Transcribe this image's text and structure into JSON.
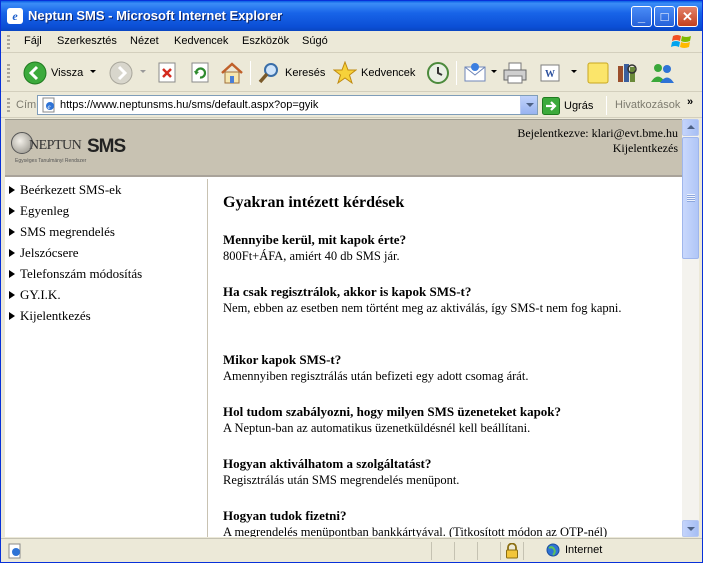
{
  "window": {
    "title": "Neptun SMS - Microsoft Internet Explorer",
    "title_icon": "ie-icon"
  },
  "menubar": {
    "items": [
      "Fájl",
      "Szerkesztés",
      "Nézet",
      "Kedvencek",
      "Eszközök",
      "Súgó"
    ]
  },
  "toolbar": {
    "back_label": "Vissza",
    "search_label": "Keresés",
    "favorites_label": "Kedvencek"
  },
  "addressbar": {
    "label": "Cím",
    "url": "https://www.neptunsms.hu/sms/default.aspx?op=gyik",
    "go_label": "Ugrás",
    "links_label": "Hivatkozások"
  },
  "site": {
    "logo_main": "NEPTUN",
    "logo_sms": "SMS",
    "logo_tagline": "Egységes Tanulmányi Rendszer",
    "login_status": "Bejelentkezve: klari@evt.bme.hu",
    "logout_link": "Kijelentkezés"
  },
  "sidebar": {
    "items": [
      "Beérkezett SMS-ek",
      "Egyenleg",
      "SMS megrendelés",
      "Jelszócsere",
      "Telefonszám módosítás",
      "GY.I.K.",
      "Kijelentkezés"
    ]
  },
  "main": {
    "title": "Gyakran intézett kérdések",
    "faq": [
      {
        "q": "Mennyibe kerül, mit kapok érte?",
        "a": "800Ft+ÁFA, amiért 40 db SMS jár."
      },
      {
        "q": "Ha csak regisztrálok, akkor is kapok SMS-t?",
        "a": "Nem, ebben az esetben nem történt meg az aktiválás, így SMS-t nem fog kapni."
      },
      {
        "q": "Mikor kapok SMS-t?",
        "a": "Amennyiben regisztrálás után befizeti egy adott csomag árát."
      },
      {
        "q": "Hol tudom szabályozni, hogy milyen SMS üzeneteket kapok?",
        "a": "A Neptun-ban az automatikus üzenetküldésnél kell beállítani."
      },
      {
        "q": "Hogyan aktiválhatom a szolgáltatást?",
        "a": "Regisztrálás után SMS megrendelés menüpont."
      },
      {
        "q": "Hogyan tudok fizetni?",
        "a": "A megrendelés menüpontban bankkártyával. (Titkosított módon az OTP-nél)"
      }
    ]
  },
  "statusbar": {
    "zone": "Internet"
  },
  "colors": {
    "titlebar": "#0a5fe6",
    "header_bg": "#c8c2b2",
    "chrome": "#ece9d8"
  }
}
